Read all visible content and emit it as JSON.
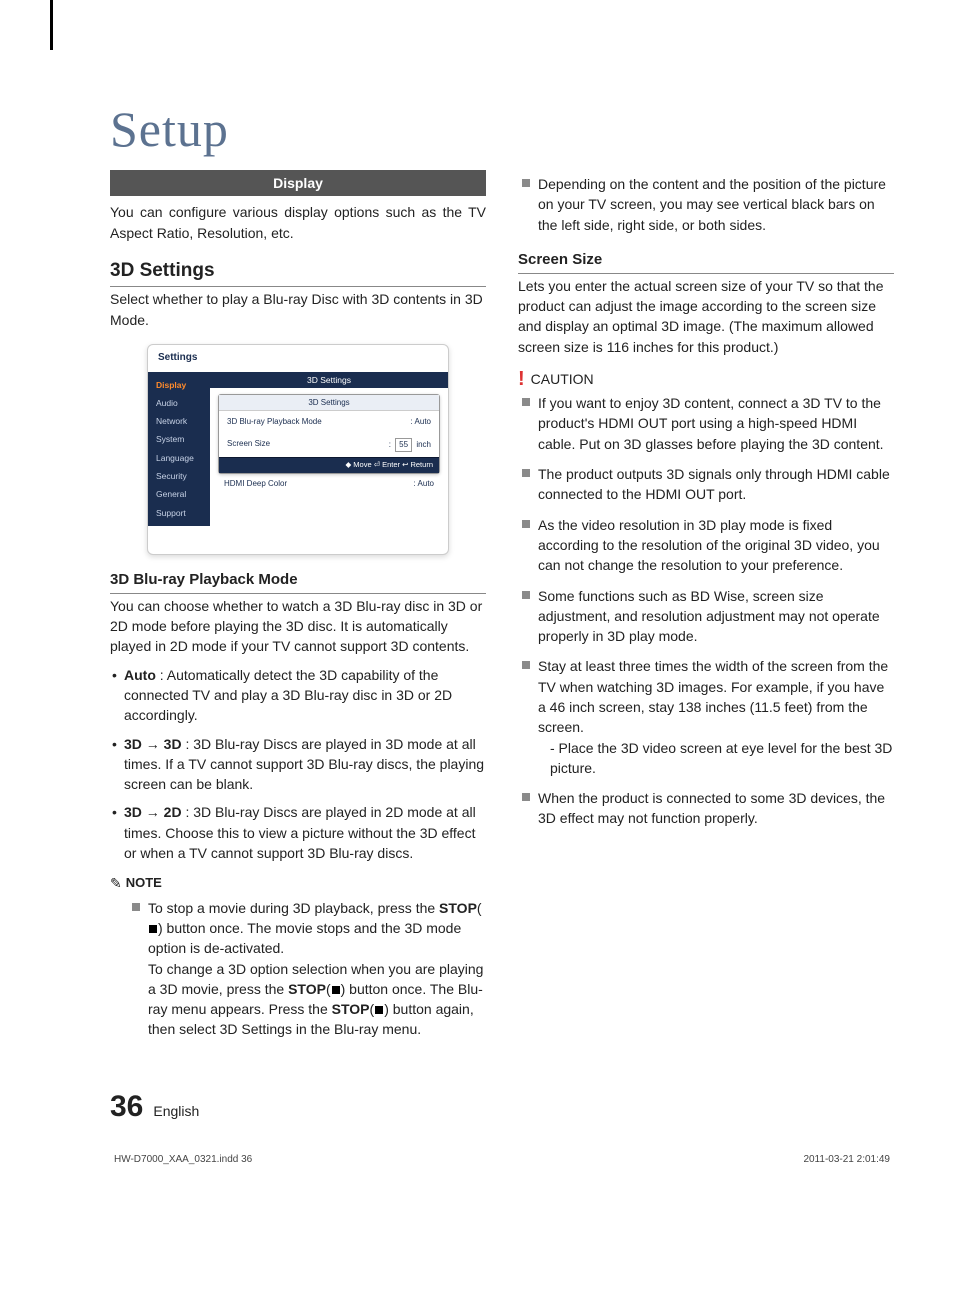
{
  "pageTitle": "Setup",
  "sectionBanner": "Display",
  "intro": "You can configure various display options such as the TV Aspect Ratio, Resolution, etc.",
  "headings": {
    "settings3d": "3D Settings",
    "playbackMode": "3D Blu-ray Playback Mode",
    "screenSize": "Screen Size"
  },
  "settings3dDesc": "Select whether to play a Blu-ray Disc with 3D contents in 3D Mode.",
  "panel": {
    "title": "Settings",
    "sidebar": [
      "Display",
      "Audio",
      "Network",
      "System",
      "Language",
      "Security",
      "General",
      "Support"
    ],
    "mainHeader": "3D Settings",
    "dialogTitle": "3D Settings",
    "row1Label": "3D Blu-ray Playback Mode",
    "row1Value": ": Auto",
    "row2Label": "Screen Size",
    "row2Prefix": ":",
    "row2Box": "55",
    "row2Suffix": "inch",
    "footer": "◆ Move   ⏎ Enter   ↩ Return",
    "bottomLabel": "HDMI Deep Color",
    "bottomValue": ": Auto"
  },
  "playbackDesc": "You can choose whether to watch a 3D Blu-ray disc in 3D or 2D mode before playing the 3D disc. It is automatically played in 2D mode if your TV cannot support 3D contents.",
  "playbackOptions": {
    "autoLabel": "Auto",
    "autoText": " : Automatically detect the 3D capability of the connected TV and play a 3D Blu-ray disc in 3D or 2D accordingly.",
    "mode3d3dLabel": "3D → 3D",
    "mode3d3dText": " : 3D Blu-ray Discs are played in 3D mode at all times. If a TV cannot support 3D Blu-ray discs, the playing screen can be blank.",
    "mode3d2dLabel": "3D → 2D",
    "mode3d2dText": " : 3D Blu-ray Discs are played in 2D mode at all times. Choose this to view a picture without the 3D effect or when a TV cannot support 3D Blu-ray discs."
  },
  "noteLabel": "NOTE",
  "noteTextA": "To stop a movie during 3D playback, press the ",
  "noteTextB": ") button once. The movie stops and the 3D mode option is de-activated.",
  "noteTextC": "To change a 3D option selection when you are playing a 3D movie, press the ",
  "noteTextD": ") button once. The Blu-ray menu appears. Press the ",
  "noteTextE": ") button again, then select 3D Settings in the Blu-ray menu.",
  "stopLabel": "STOP",
  "rightIntro": "Depending on the content and the position of the picture on your TV screen, you may see vertical black bars on the left side, right side, or both sides.",
  "screenSizeDesc": "Lets you enter the actual screen size of your TV so that the product can adjust the image according to the screen size and display an optimal 3D image. (The maximum allowed screen size is 116 inches for this product.)",
  "cautionLabel": "CAUTION",
  "cautions": [
    "If you want to enjoy 3D content, connect a 3D TV to the product's HDMI OUT port using a high-speed HDMI cable. Put on 3D glasses before playing the 3D content.",
    "The product outputs 3D signals only through HDMI cable connected to the HDMI OUT port.",
    "As the video resolution in 3D play mode is fixed according to the resolution of the original 3D video, you can not change the resolution to your preference.",
    "Some functions such as BD Wise, screen size adjustment, and resolution adjustment may not operate properly in 3D play mode."
  ],
  "cautionStay": "Stay at least three times the width of the screen from the TV when watching 3D images. For example, if you have a 46 inch screen, stay 138 inches (11.5 feet) from the screen.",
  "cautionStaySub": "- Place the 3D video screen at eye level for the best 3D picture.",
  "cautionLast": "When the product is connected to some 3D devices, the 3D effect may not function properly.",
  "footer": {
    "pageNum": "36",
    "lang": "English",
    "printLeft": "HW-D7000_XAA_0321.indd   36",
    "printRight": "2011-03-21   2:01:49"
  }
}
